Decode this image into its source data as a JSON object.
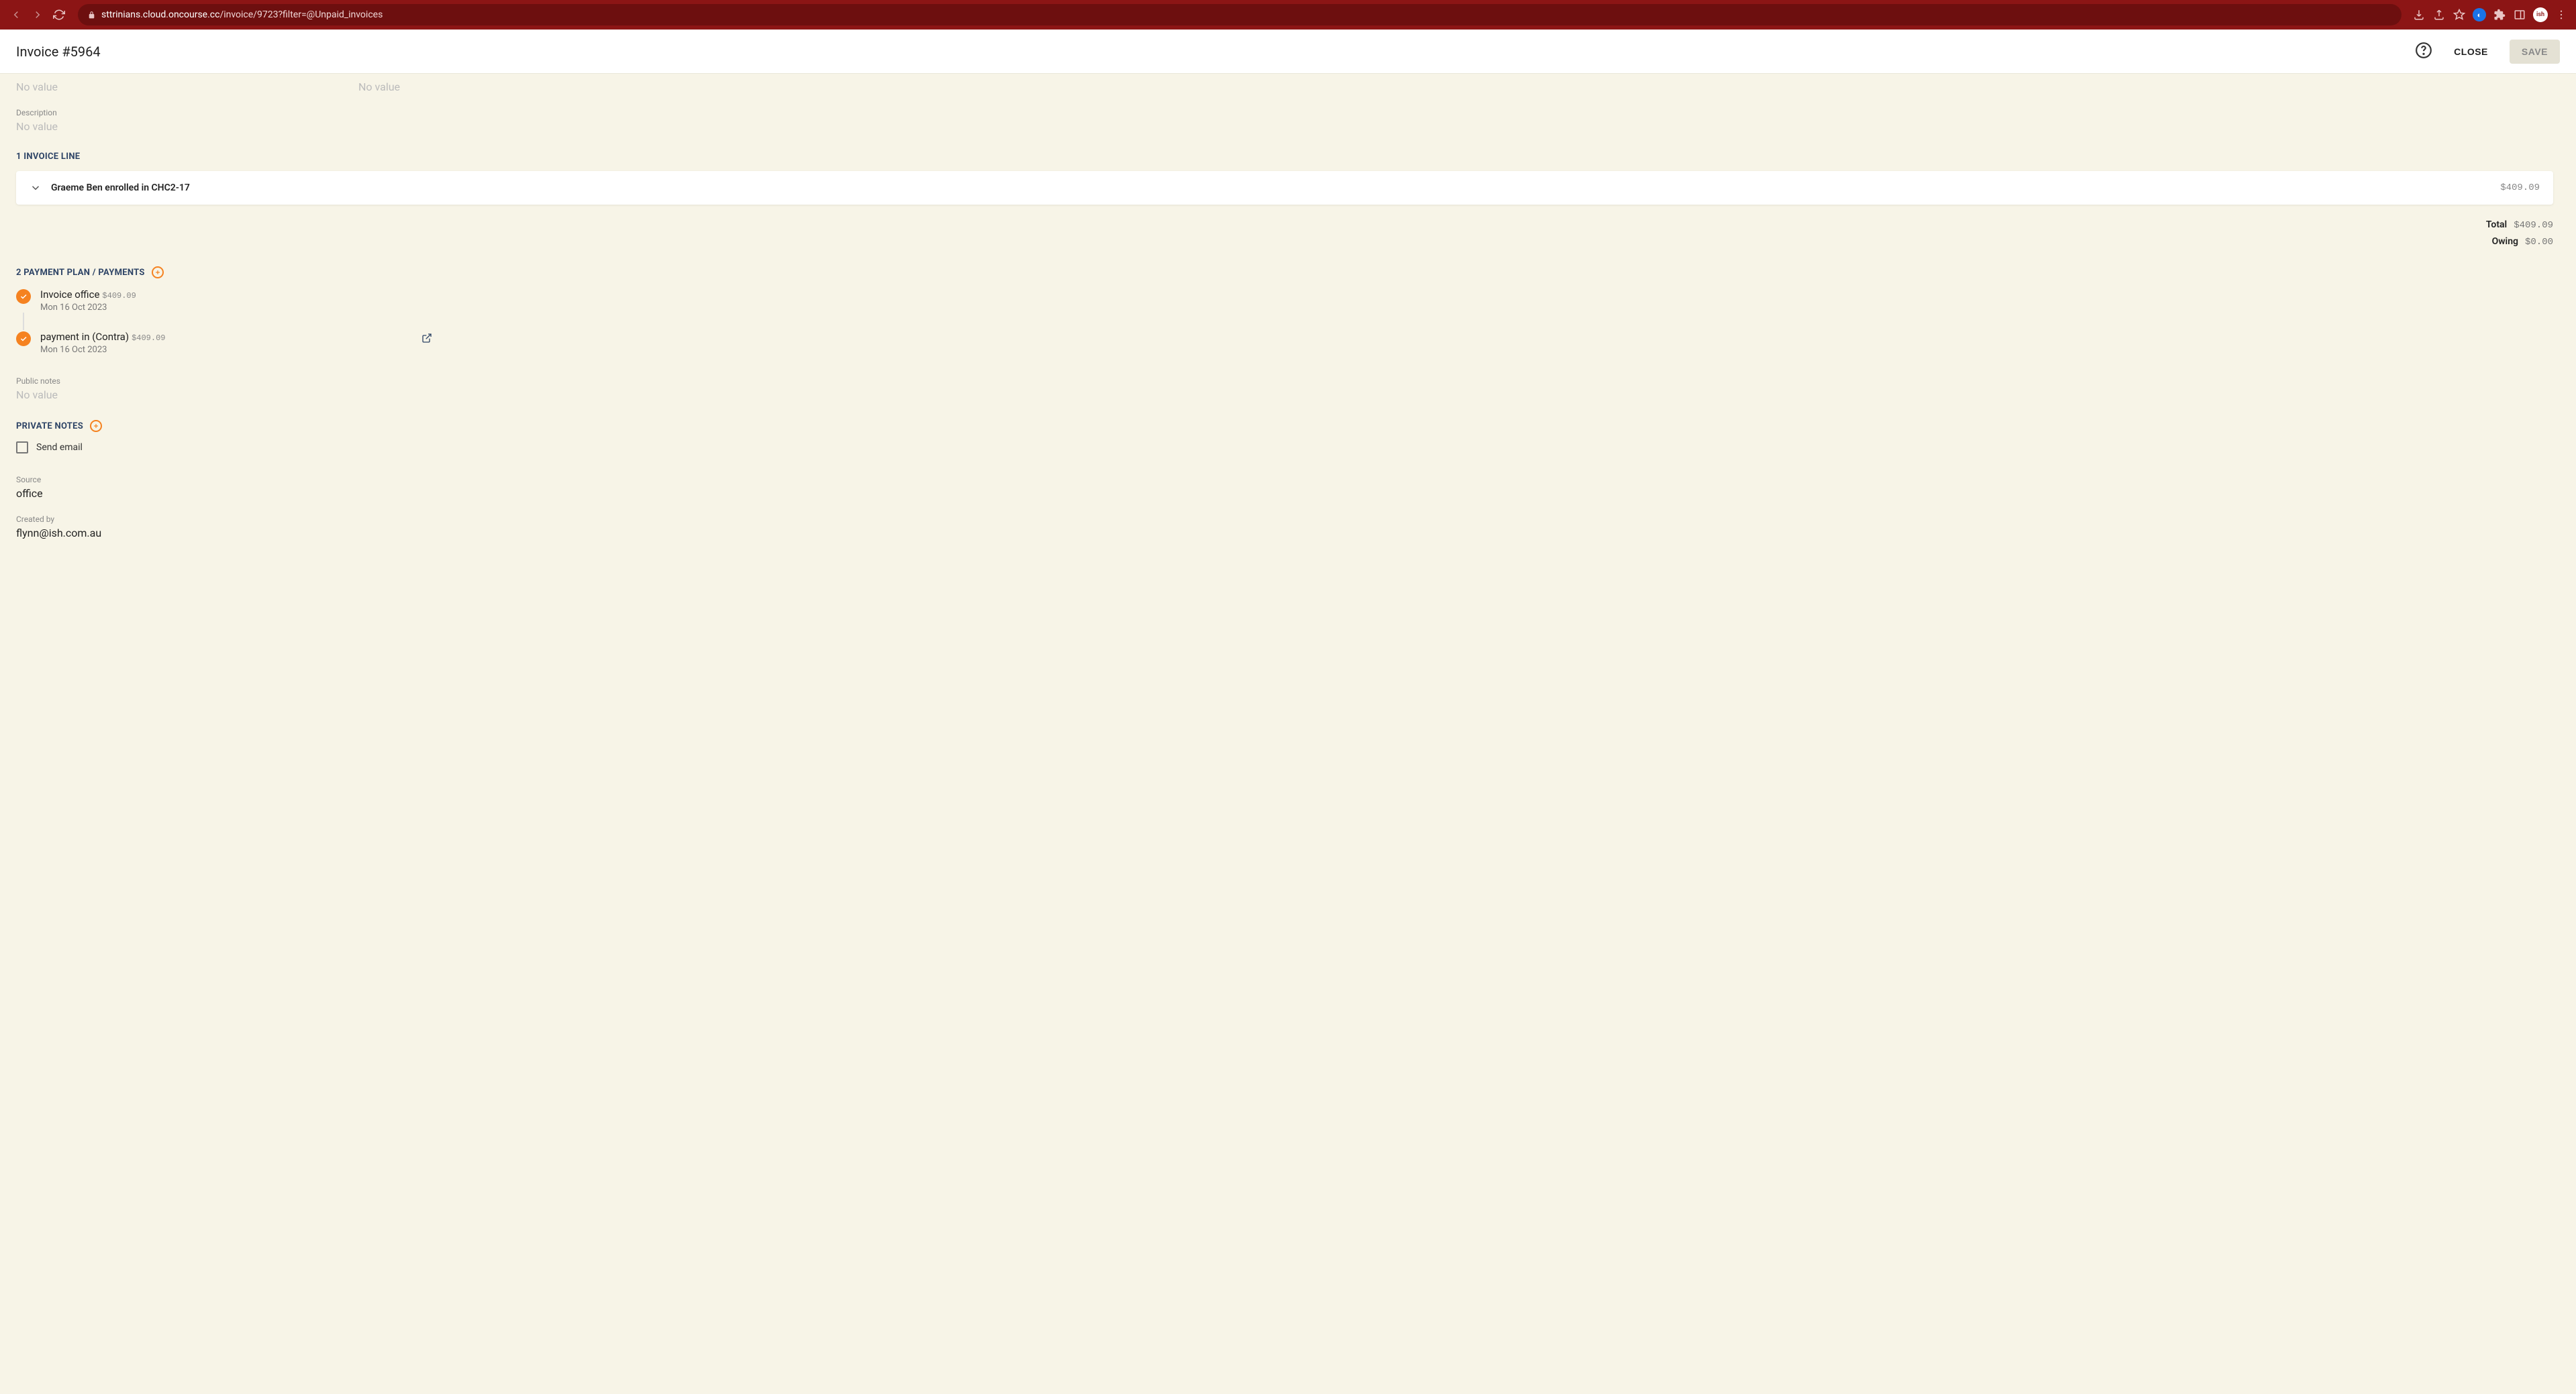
{
  "browser": {
    "url_domain": "sttrinians.cloud.oncourse.cc",
    "url_path": "/invoice/9723?filter=@Unpaid_invoices",
    "avatar": "ish"
  },
  "header": {
    "title": "Invoice #5964",
    "close_label": "CLOSE",
    "save_label": "SAVE"
  },
  "fields": {
    "top_left_value": "No value",
    "top_right_value": "No value",
    "description_label": "Description",
    "description_value": "No value",
    "public_notes_label": "Public notes",
    "public_notes_value": "No value",
    "source_label": "Source",
    "source_value": "office",
    "created_by_label": "Created by",
    "created_by_value": "flynn@ish.com.au"
  },
  "sections": {
    "invoice_lines_title": "1 INVOICE LINE",
    "payments_title": "2 PAYMENT PLAN / PAYMENTS",
    "private_notes_title": "PRIVATE NOTES"
  },
  "invoice_line": {
    "title": "Graeme Ben enrolled in CHC2-17",
    "amount": "$409.09"
  },
  "totals": {
    "total_label": "Total",
    "total_value": "$409.09",
    "owing_label": "Owing",
    "owing_value": "$0.00"
  },
  "payments": [
    {
      "title": "Invoice office",
      "amount": "$409.09",
      "date": "Mon 16 Oct 2023"
    },
    {
      "title": "payment in (Contra)",
      "amount": "$409.09",
      "date": "Mon 16 Oct 2023"
    }
  ],
  "send_email_label": "Send email"
}
